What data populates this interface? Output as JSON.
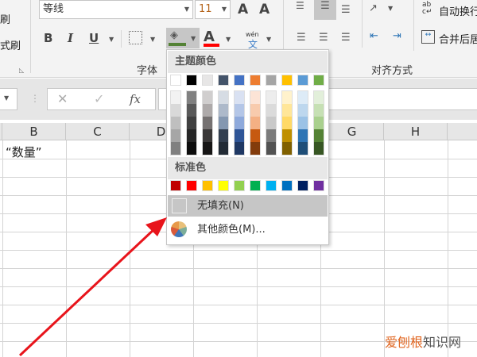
{
  "ribbon": {
    "clipboard_partial": [
      "刷",
      "式刷"
    ],
    "font_name": "等线",
    "font_size": "11",
    "bold": "B",
    "italic": "I",
    "underline": "U",
    "increase_font": "A",
    "decrease_font": "A",
    "font_color": "A",
    "font_color_value": "#ff0000",
    "fill_color_value": "#548235",
    "phonetic_top": "wén",
    "phonetic_bottom": "文",
    "font_group_label": "字体",
    "align_group_label": "对齐方式",
    "wrap_text": "自动换行",
    "merge_center": "合并后居中"
  },
  "formula_bar": {
    "cancel": "✕",
    "enter": "✓",
    "fx": "fx"
  },
  "columns": [
    "B",
    "C",
    "D",
    "E",
    "F",
    "G",
    "H"
  ],
  "cells": {
    "B1": "“数量”"
  },
  "color_menu": {
    "theme_header": "主题颜色",
    "theme_colors": [
      "#ffffff",
      "#000000",
      "#e7e6e6",
      "#44546a",
      "#4472c4",
      "#ed7d31",
      "#a5a5a5",
      "#ffc000",
      "#5b9bd5",
      "#70ad47"
    ],
    "theme_shades": [
      [
        "#f2f2f2",
        "#d9d9d9",
        "#bfbfbf",
        "#a6a6a6",
        "#808080"
      ],
      [
        "#808080",
        "#595959",
        "#404040",
        "#262626",
        "#0d0d0d"
      ],
      [
        "#d0cece",
        "#aeaaaa",
        "#757171",
        "#3a3838",
        "#171616"
      ],
      [
        "#d6dce4",
        "#adb9ca",
        "#8497b0",
        "#333f4f",
        "#222b35"
      ],
      [
        "#d9e1f2",
        "#b4c6e7",
        "#8ea9db",
        "#2f5597",
        "#1f3864"
      ],
      [
        "#fce4d6",
        "#f8cbad",
        "#f4b084",
        "#c65911",
        "#833c0c"
      ],
      [
        "#ededed",
        "#dbdbdb",
        "#c9c9c9",
        "#7b7b7b",
        "#525252"
      ],
      [
        "#fff2cc",
        "#ffe699",
        "#ffd966",
        "#bf8f00",
        "#806000"
      ],
      [
        "#ddebf7",
        "#bdd7ee",
        "#9bc2e6",
        "#2f75b5",
        "#1f4e78"
      ],
      [
        "#e2efda",
        "#c6e0b4",
        "#a9d08e",
        "#548235",
        "#375623"
      ]
    ],
    "standard_header": "标准色",
    "standard_colors": [
      "#c00000",
      "#ff0000",
      "#ffc000",
      "#ffff00",
      "#92d050",
      "#00b050",
      "#00b0f0",
      "#0070c0",
      "#002060",
      "#7030a0"
    ],
    "no_fill": "无填充(N)",
    "more_colors": "其他颜色(M)..."
  },
  "annotation_color": "#e8141b",
  "watermark": {
    "part1": "爱刨根",
    "part2": "知识网"
  }
}
